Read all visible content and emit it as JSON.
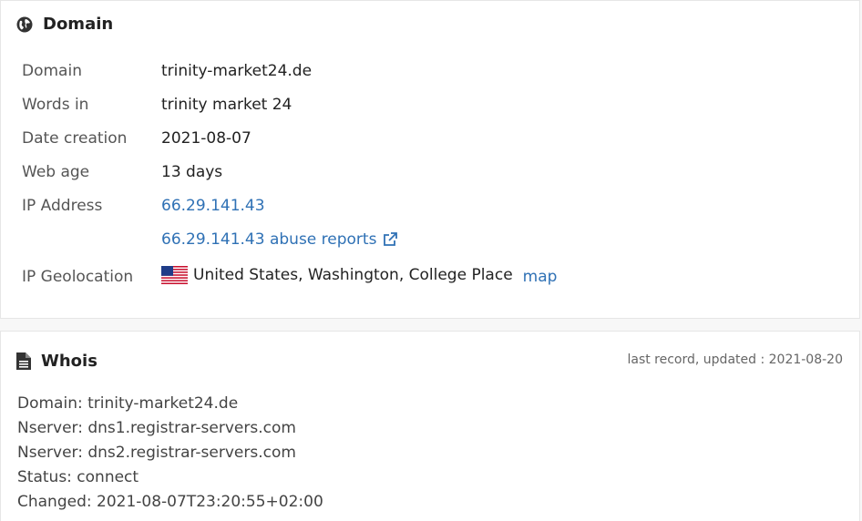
{
  "domain_section": {
    "title": "Domain",
    "rows": [
      {
        "label": "Domain",
        "value": "trinity-market24.de"
      },
      {
        "label": "Words in",
        "value": "trinity market 24"
      },
      {
        "label": "Date creation",
        "value": "2021-08-07"
      },
      {
        "label": "Web age",
        "value": "13 days"
      },
      {
        "label": "IP Address",
        "value": "66.29.141.43"
      },
      {
        "label": "",
        "value": "66.29.141.43 abuse reports"
      },
      {
        "label": "IP Geolocation",
        "value": "United States, Washington, College Place",
        "link": "map"
      }
    ]
  },
  "whois_section": {
    "title": "Whois",
    "updated": "last record, updated : 2021-08-20",
    "lines": [
      "Domain: trinity-market24.de",
      "Nserver: dns1.registrar-servers.com",
      "Nserver: dns2.registrar-servers.com",
      "Status: connect",
      "Changed: 2021-08-07T23:20:55+02:00"
    ]
  },
  "icons": {
    "domain_header": "globe-icon",
    "whois_header": "document-icon",
    "abuse_link": "external-link-icon",
    "geolocation": "us-flag-icon"
  },
  "colors": {
    "link": "#2f71b5",
    "text": "#222222",
    "label": "#555555"
  }
}
